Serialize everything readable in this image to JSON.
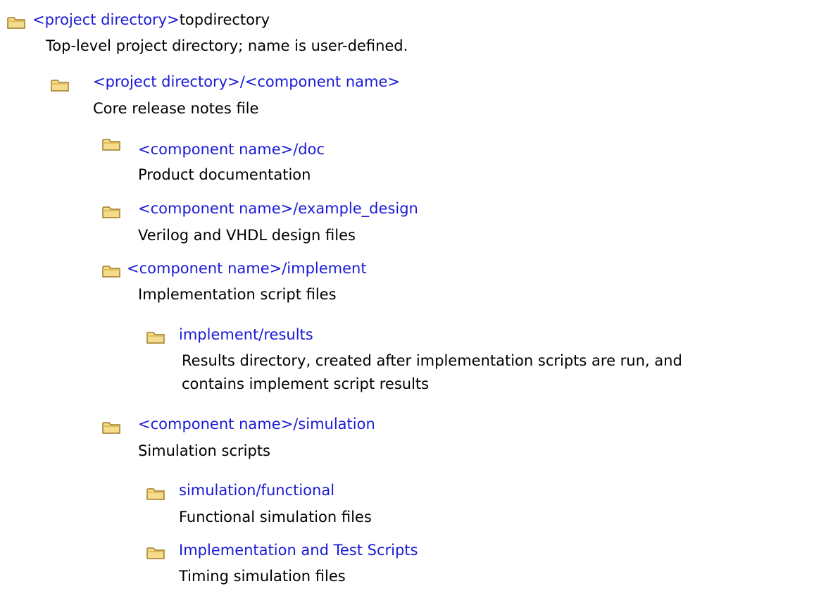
{
  "tree": [
    {
      "title_link": "<project directory>",
      "title_plain": "topdirectory",
      "desc": [
        "Top-level project directory; name is user-defined."
      ]
    },
    {
      "title_link": "<project directory>/<component name>",
      "title_plain": "",
      "desc": [
        "Core release notes file"
      ]
    },
    {
      "title_link": "<component name>/doc",
      "title_plain": "",
      "desc": [
        "Product documentation"
      ]
    },
    {
      "title_link": "<component name>/example_design",
      "title_plain": "",
      "desc": [
        "Verilog and VHDL design files"
      ]
    },
    {
      "title_link": "<component name>/implement",
      "title_plain": "",
      "desc": [
        "Implementation script files"
      ]
    },
    {
      "title_link": "implement/results",
      "title_plain": "",
      "desc": [
        "Results directory, created after implementation scripts are run, and",
        "contains implement script results"
      ]
    },
    {
      "title_link": "<component name>/simulation",
      "title_plain": "",
      "desc": [
        "Simulation scripts"
      ]
    },
    {
      "title_link": "simulation/functional",
      "title_plain": "",
      "desc": [
        "Functional simulation files"
      ]
    },
    {
      "title_link": "Implementation and Test Scripts",
      "title_plain": "",
      "desc": [
        "Timing simulation files"
      ]
    }
  ],
  "colors": {
    "link": "#1a1ad6",
    "text": "#000000",
    "folder_fill": "#f5dc8c",
    "folder_stroke": "#a07c28"
  }
}
